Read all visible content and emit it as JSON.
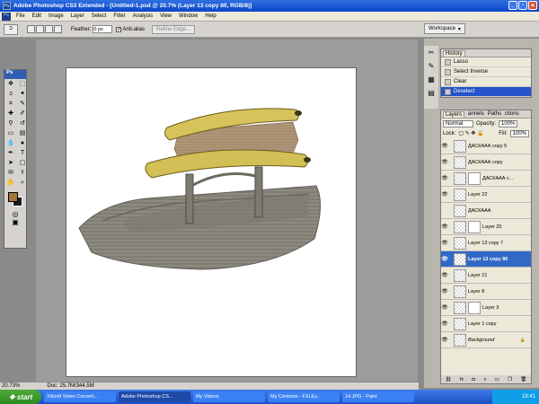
{
  "window": {
    "title": "Adobe Photoshop CS3 Extended - [Untitled-1.psd @ 20.7% (Layer 13 copy 80, RGB/8)]"
  },
  "menu": [
    "File",
    "Edit",
    "Image",
    "Layer",
    "Select",
    "Filter",
    "Analysis",
    "View",
    "Window",
    "Help"
  ],
  "options": {
    "feather_label": "Feather:",
    "feather_value": "0 px",
    "antialias_label": "Anti-alias",
    "refine_label": "Refine Edge...",
    "workspace_label": "Workspace"
  },
  "toolbox": {
    "badge": "Ps"
  },
  "status": {
    "zoom": "20.73%",
    "doc": "Doc: 25.7M/344.5M"
  },
  "history": {
    "tab": "History",
    "items": [
      {
        "label": "Lasso",
        "selected": false
      },
      {
        "label": "Select Inverse",
        "selected": false
      },
      {
        "label": "Clear",
        "selected": false
      },
      {
        "label": "Deselect",
        "selected": true
      }
    ]
  },
  "layers": {
    "tabs": [
      "Layers",
      "annels",
      "Paths",
      "ctions"
    ],
    "blend": "Normal",
    "opacity_label": "Opacity:",
    "opacity": "100%",
    "lock_label": "Lock:",
    "fill_label": "Fill:",
    "fill": "100%",
    "items": [
      {
        "name": "ДАСКААА copy 5",
        "visible": true,
        "mask": false,
        "selected": false
      },
      {
        "name": "ДАСКААА copy",
        "visible": true,
        "mask": false,
        "selected": false
      },
      {
        "name": "ДАСКААА с...",
        "visible": true,
        "mask": true,
        "selected": false
      },
      {
        "name": "Layer 22",
        "visible": true,
        "mask": false,
        "selected": false
      },
      {
        "name": "ДАСКААА",
        "visible": false,
        "mask": false,
        "selected": false
      },
      {
        "name": "Layer 25",
        "visible": true,
        "mask": true,
        "selected": false
      },
      {
        "name": "Layer 13 copy 7",
        "visible": true,
        "mask": false,
        "selected": false
      },
      {
        "name": "Layer 13 copy 80",
        "visible": true,
        "mask": false,
        "selected": true
      },
      {
        "name": "Layer 21",
        "visible": true,
        "mask": false,
        "selected": false
      },
      {
        "name": "Layer 8",
        "visible": true,
        "mask": false,
        "selected": false
      },
      {
        "name": "Layer 3",
        "visible": true,
        "mask": true,
        "selected": false
      },
      {
        "name": "Layer 1 copy",
        "visible": true,
        "mask": false,
        "selected": false
      },
      {
        "name": "Background",
        "visible": true,
        "mask": false,
        "selected": false,
        "locked": true
      }
    ],
    "footer_icons": [
      "link",
      "fx",
      "mask",
      "adjust",
      "group",
      "new",
      "trash"
    ]
  },
  "taskbar": {
    "start": "start",
    "tasks": [
      {
        "label": "Xilisoft Video Convert...",
        "active": false
      },
      {
        "label": "Adobe Photoshop CS...",
        "active": true
      },
      {
        "label": "My Videos",
        "active": false
      },
      {
        "label": "My Contests - FXLEy...",
        "active": false
      },
      {
        "label": "14.JPG - Paint",
        "active": false
      }
    ],
    "clock": "18:41"
  },
  "colors": {
    "foreground": "#a0763d",
    "background": "#1b1b1b",
    "selection": "#3169c6"
  }
}
